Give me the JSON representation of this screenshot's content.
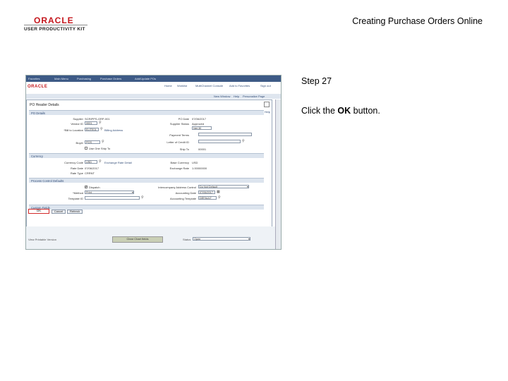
{
  "slide": {
    "logo_oracle": "ORACLE",
    "logo_tagline": "USER PRODUCTIVITY KIT",
    "title": "Creating Purchase Orders Online",
    "step": "Step 27",
    "instruction_pre": "Click the ",
    "instruction_bold": "OK",
    "instruction_post": " button."
  },
  "screenshot": {
    "topnav": [
      "Favorites",
      "Main Menu",
      "Purchasing",
      "Purchase Orders",
      "Add/Update POs"
    ],
    "brand": "ORACLE",
    "header_links": [
      "Home",
      "Worklist",
      "MultiChannel Console",
      "Add to Favorites",
      "Sign out"
    ],
    "subbar_links": [
      "New Window",
      "Help",
      "Personalize Page"
    ],
    "modal_title": "PO Header Details",
    "help_link": "Help",
    "sections": {
      "po_details": "PO Details",
      "currency": "Currency",
      "process_control": "Process Control Defaults",
      "custom_fields": "Custom Fields"
    },
    "fields": {
      "supplier_label": "Supplier",
      "supplier_value": "SCRIPPS-GRP-001",
      "vendor_id_label": "Vendor ID",
      "vendor_id_value": "0001",
      "location_label": "*Bill to Location",
      "location_value": "ELITE01",
      "buyer_label": "Buyer",
      "buyer_value": "POS",
      "use_one_ship_to": "Use One Ship To",
      "po_date_label": "PO Date",
      "po_date_value": "07/06/2017",
      "supplier_status_label": "Supplier Status",
      "supplier_status_value": "Approved",
      "payment_terms_label": "Payment Terms",
      "payment_terms_value": "Net 30",
      "letter_of_credit_label": "Letter of Credit ID",
      "ship_to_label": "Ship To",
      "ship_to_value": "00001",
      "billing_address_link": "Billing Address",
      "currency_code_label": "Currency Code",
      "currency_code_value": "USD",
      "exchange_rate_link": "Exchange Rate Detail",
      "rate_date_label": "Rate Date",
      "rate_date_value": "07/06/2017",
      "rate_type_label": "Rate Type",
      "rate_type_value": "CRRNT",
      "base_currency_label": "Base Currency",
      "base_currency_value": "USD",
      "exchange_rate_label": "Exchange Rate",
      "exchange_rate_value": "1.00000000",
      "dispatch_label": "Dispatch",
      "method_label": "*Method",
      "method_value": "Print",
      "template_label": "Template ID",
      "intercompany_label": "Intercompany Address Control",
      "intercompany_value": "Do Not Default",
      "accounting_date_label": "Accounting Date",
      "accounting_date_value": "07/06/2017",
      "accounting_template_label": "Accounting Template",
      "accounting_template_value": "DEFAULT"
    },
    "buttons": {
      "ok": "OK",
      "cancel": "Cancel",
      "refresh": "Refresh"
    },
    "below": {
      "view_printable": "View Printable Version",
      "clear_chartfields": "Clear Chart fields",
      "status_label": "Status",
      "status_value": "Open"
    }
  }
}
